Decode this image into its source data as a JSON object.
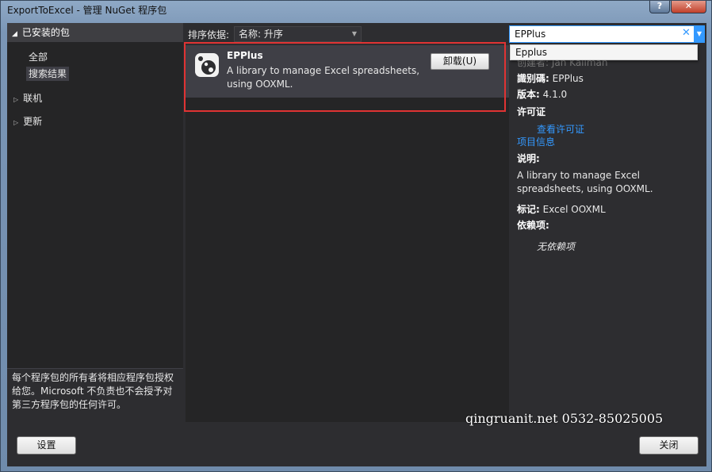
{
  "window": {
    "title": "ExportToExcel - 管理 NuGet 程序包",
    "help_label": "?",
    "close_label": "✕"
  },
  "left": {
    "installed_header": "已安装的包",
    "installed_items": [
      "全部",
      "搜索结果"
    ],
    "groups": [
      "联机",
      "更新"
    ],
    "disclaimer": "每个程序包的所有者将相应程序包授权给您。Microsoft 不负责也不会授予对第三方程序包的任何许可。"
  },
  "sort": {
    "label": "排序依据:",
    "value": "名称: 升序"
  },
  "package": {
    "name": "EPPlus",
    "description": "A library to manage Excel spreadsheets, using OOXML.",
    "uninstall_label": "卸载(U)",
    "icon": "nuget-package-icon"
  },
  "search": {
    "value": "EPPlus",
    "suggestion": "Epplus"
  },
  "details": {
    "creator_partial": "创建者: Jan Källman",
    "id_label": "識别碼:",
    "id_value": "EPPlus",
    "version_label": "版本:",
    "version_value": "4.1.0",
    "license_label": "许可证",
    "view_license": "查看许可证",
    "project_info": "项目信息",
    "description_label": "说明:",
    "description": "A library to manage Excel spreadsheets, using OOXML.",
    "tags_label": "标记:",
    "tags_value": "Excel OOXML",
    "deps_label": "依赖项:",
    "no_deps": "无依赖项"
  },
  "watermark": "qingruanit.net 0532-85025005",
  "footer": {
    "settings_label": "设置",
    "close_label": "关闭"
  },
  "colors": {
    "accent": "#3399ff",
    "highlight_border": "#e03333",
    "dark_bg": "#2d2d30"
  }
}
